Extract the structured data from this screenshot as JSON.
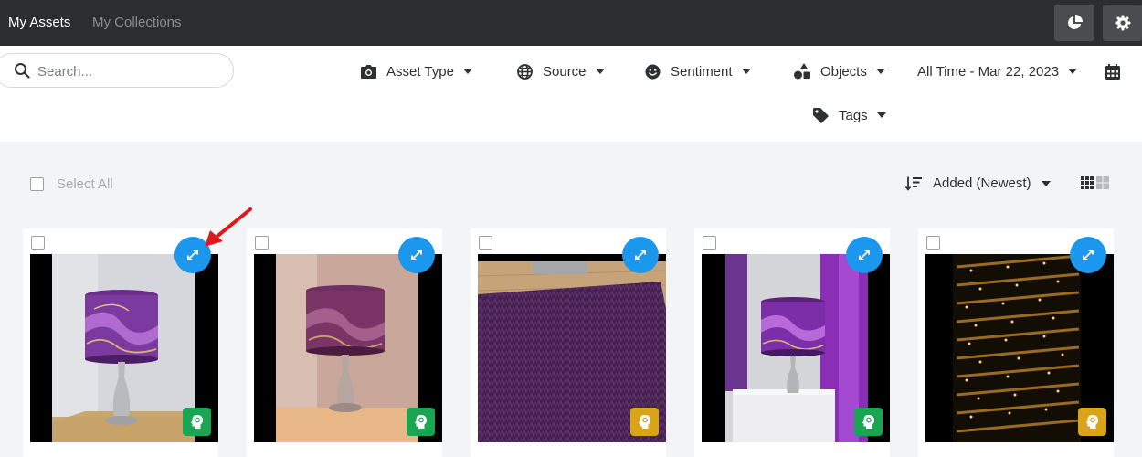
{
  "topbar": {
    "tabs": [
      {
        "label": "My Assets",
        "active": true
      },
      {
        "label": "My Collections",
        "active": false
      }
    ],
    "buttons": [
      "pie-chart-icon",
      "gear-icon"
    ]
  },
  "search": {
    "placeholder": "Search...",
    "value": ""
  },
  "filters": [
    {
      "label": "Asset Type",
      "icon": "camera-icon"
    },
    {
      "label": "Source",
      "icon": "globe-icon"
    },
    {
      "label": "Sentiment",
      "icon": "smiley-icon"
    },
    {
      "label": "Objects",
      "icon": "shapes-icon"
    },
    {
      "label": "All Time - Mar 22, 2023",
      "icon": "calendar-icon"
    },
    {
      "label": "Tags",
      "icon": "tag-icon"
    }
  ],
  "toolbar": {
    "select_all": "Select All",
    "sort_label": "Added (Newest)",
    "view": "grid"
  },
  "assets": [
    {
      "subject": "purple marble drum lamp shade on silver lamp",
      "ai_status": "green"
    },
    {
      "subject": "purple marble drum lamp shade on silver lamp",
      "ai_status": "green"
    },
    {
      "subject": "purple shag rug on wooden floor",
      "ai_status": "gold"
    },
    {
      "subject": "purple lamp beside purple curtain on white table",
      "ai_status": "green"
    },
    {
      "subject": "building facade with lit windows at night",
      "ai_status": "gold"
    }
  ],
  "colors": {
    "topbar": "#2b2d30",
    "accent_blue": "#1b97ee",
    "badge_green": "#1aa553",
    "badge_gold": "#d9a418",
    "annotation_arrow": "#e0191c"
  }
}
